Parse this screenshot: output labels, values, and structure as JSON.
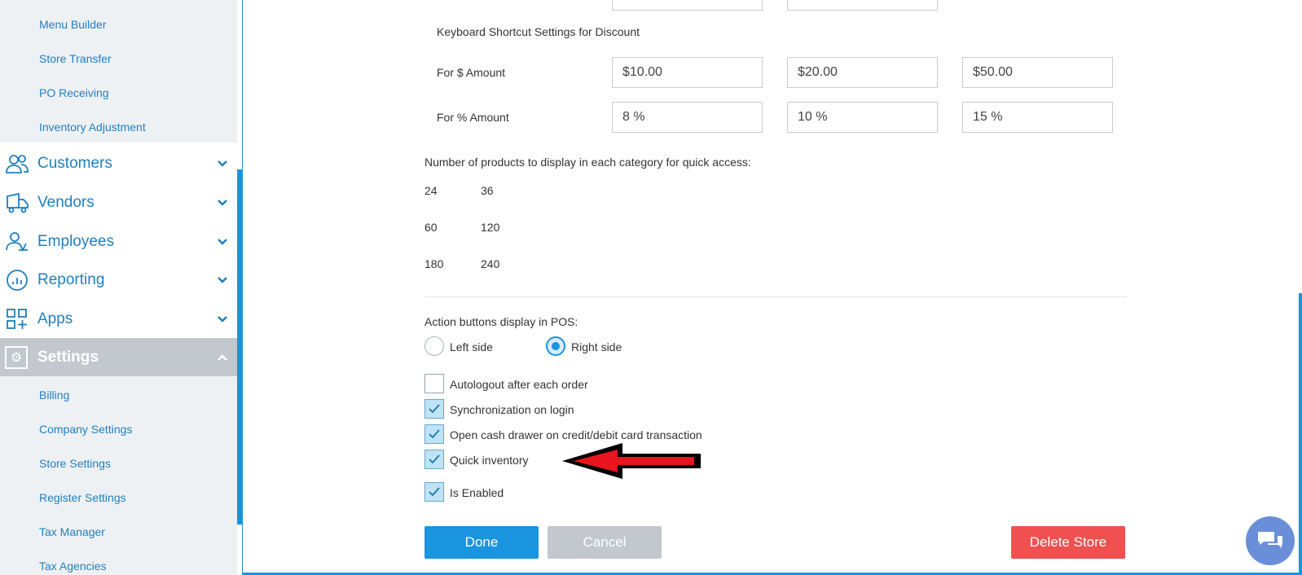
{
  "sidebar": {
    "top_subitems": [
      "Menu Builder",
      "Store Transfer",
      "PO Receiving",
      "Inventory Adjustment"
    ],
    "nav": [
      {
        "label": "Customers",
        "icon": "users-icon"
      },
      {
        "label": "Vendors",
        "icon": "truck-icon"
      },
      {
        "label": "Employees",
        "icon": "employee-icon"
      },
      {
        "label": "Reporting",
        "icon": "chart-icon"
      },
      {
        "label": "Apps",
        "icon": "apps-grid-icon"
      },
      {
        "label": "Settings",
        "icon": "gear-icon"
      }
    ],
    "settings_subitems": [
      "Billing",
      "Company Settings",
      "Store Settings",
      "Register Settings",
      "Tax Manager",
      "Tax Agencies"
    ]
  },
  "main": {
    "discount_heading": "Keyboard Shortcut Settings for Discount",
    "amount_row": {
      "label": "For $ Amount",
      "values": [
        "$10.00",
        "$20.00",
        "$50.00"
      ]
    },
    "percent_row": {
      "label": "For % Amount",
      "values": [
        "8 %",
        "10 %",
        "15 %"
      ]
    },
    "quick_access_label": "Number of products to display in each category for quick access:",
    "quick_access_options": [
      "24",
      "36",
      "60",
      "120",
      "180",
      "240"
    ],
    "action_buttons_label": "Action buttons display in POS:",
    "radio_options": [
      {
        "label": "Left side",
        "checked": false
      },
      {
        "label": "Right side",
        "checked": true
      }
    ],
    "checkboxes": [
      {
        "label": "Autologout after each order",
        "checked": false
      },
      {
        "label": "Synchronization on login",
        "checked": true
      },
      {
        "label": "Open cash drawer on credit/debit card transaction",
        "checked": true
      },
      {
        "label": "Quick inventory",
        "checked": true
      },
      {
        "label": "Is Enabled",
        "checked": true
      }
    ],
    "buttons": {
      "done": "Done",
      "cancel": "Cancel",
      "delete": "Delete Store"
    }
  },
  "colors": {
    "accent": "#1a94de",
    "danger": "#f05050",
    "muted": "#c3c8cf",
    "sidebar_text": "#1f7fc0"
  }
}
